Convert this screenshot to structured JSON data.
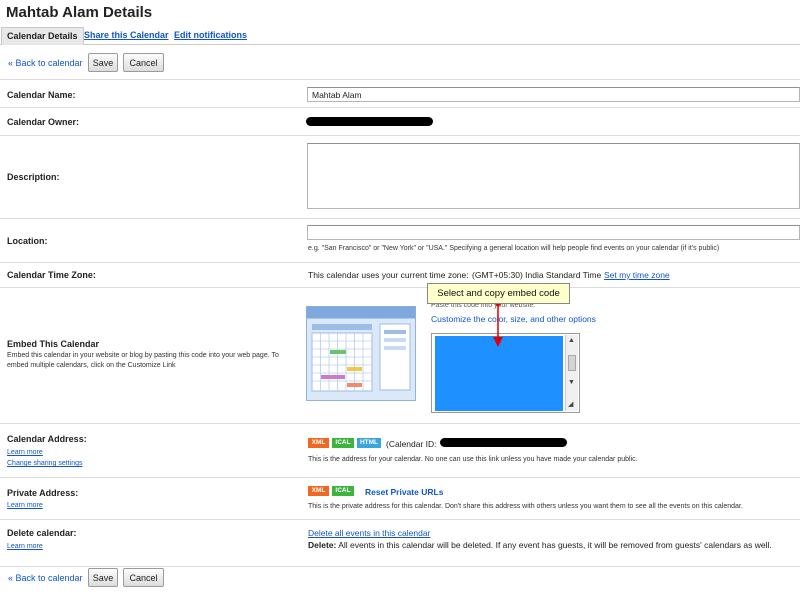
{
  "page": {
    "title": "Mahtab Alam Details",
    "tabs": [
      {
        "label": "Calendar Details"
      },
      {
        "label": "Share this Calendar"
      },
      {
        "label": "Edit notifications"
      }
    ],
    "back_link": "« Back to calendar",
    "save_label": "Save",
    "cancel_label": "Cancel"
  },
  "calendar_name": {
    "label": "Calendar Name:",
    "value": "Mahtab Alam"
  },
  "calendar_owner": {
    "label": "Calendar Owner:"
  },
  "description": {
    "label": "Description:",
    "value": ""
  },
  "location": {
    "label": "Location:",
    "value": "",
    "hint": "e.g. \"San Francisco\" or \"New York\" or \"USA.\" Specifying a general location will help people find events on your calendar (if it's public)"
  },
  "time_zone": {
    "label": "Calendar Time Zone:",
    "text": "This calendar uses your current time zone:",
    "zone": "(GMT+05:30) India Standard Time",
    "link": "Set my time zone"
  },
  "embed": {
    "label": "Embed This Calendar",
    "help": "Embed this calendar in your website or blog by pasting this code into your web page. To embed multiple calendars, click on the Customize Link",
    "paste_text": "Paste this code into your website.",
    "customize_link": "Customize the color, size, and other options",
    "tooltip": "Select and copy embed code",
    "colors": {
      "selection": "#1e90ff",
      "pointer": "#e00000"
    }
  },
  "calendar_address": {
    "label": "Calendar Address:",
    "learn_more": "Learn more",
    "change_sharing": "Change sharing settings",
    "badges": [
      "XML",
      "ICAL",
      "HTML"
    ],
    "calendar_id_label": "(Calendar ID:",
    "note": "This is the address for your calendar. No one can use this link unless you have made your calendar public."
  },
  "private_address": {
    "label": "Private Address:",
    "learn_more": "Learn more",
    "badges": [
      "XML",
      "ICAL"
    ],
    "reset_link": "Reset Private URLs",
    "note": "This is the private address for this calendar. Don't share this address with others unless you want them to see all the events on this calendar."
  },
  "delete_calendar": {
    "label": "Delete calendar:",
    "learn_more": "Learn more",
    "link": "Delete all events in this calendar",
    "note_bold": "Delete:",
    "note": "All events in this calendar will be deleted. If any event has guests, it will be removed from guests' calendars as well."
  },
  "badge_colors": {
    "XML": "#f26722",
    "ICAL": "#3db43d",
    "HTML": "#3aa6dd"
  }
}
